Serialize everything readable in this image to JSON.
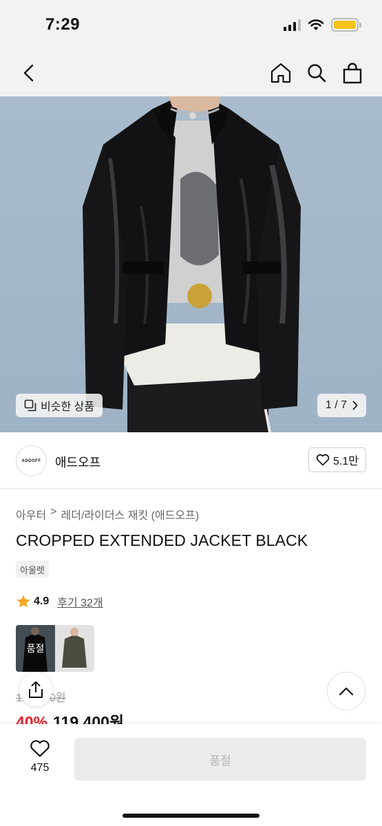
{
  "status": {
    "time": "7:29"
  },
  "nav": {
    "icons": [
      "chevron-left-icon",
      "home-icon",
      "search-icon",
      "bag-icon"
    ]
  },
  "hero": {
    "similar_label": "비슷한 상품",
    "pager": "1 / 7"
  },
  "brand": {
    "logo_text": "ADDOFF",
    "name": "애드오프",
    "likes": "5.1만"
  },
  "breadcrumb": {
    "category": "아우터",
    "separator": ">",
    "subcategory": "레더/라이더스 재킷 (애드오프)"
  },
  "product": {
    "title": "CROPPED EXTENDED JACKET BLACK",
    "tag": "아울렛",
    "rating": "4.9",
    "reviews": "후기 32개",
    "original_price": "199,000원",
    "discount": "40%",
    "price": "119,400원"
  },
  "thumbnails": [
    {
      "label": "품절",
      "soldout": true
    },
    {
      "label": "",
      "soldout": false
    }
  ],
  "bottom": {
    "like_count": "475",
    "cta_label": "품절"
  },
  "colors": {
    "accent_red": "#e8232a",
    "star": "#f5a623",
    "battery": "#f5c518"
  }
}
